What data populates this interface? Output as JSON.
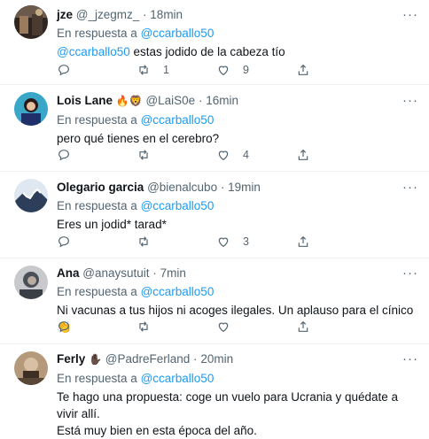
{
  "tweets": [
    {
      "name": "jze",
      "badges": "",
      "handle": "@_jzegmz_",
      "time": "18min",
      "reply_prefix": "En respuesta a",
      "reply_to": "@ccarballo50",
      "text_mention": "@ccarballo50",
      "text": " estas jodido de la cabeza tío",
      "retweets": "1",
      "likes": "9",
      "avatar_colors": [
        "#3b2a22",
        "#8a6a52"
      ]
    },
    {
      "name": "Lois Lane",
      "badges": "🔥🦁",
      "handle": "@LaiS0e",
      "time": "16min",
      "reply_prefix": "En respuesta a",
      "reply_to": "@ccarballo50",
      "text": "pero qué tienes en el cerebro?",
      "retweets": "",
      "likes": "4",
      "avatar_colors": [
        "#3aa6c8",
        "#1f2f6a"
      ]
    },
    {
      "name": "Olegario garcia",
      "badges": "",
      "handle": "@bienalcubo",
      "time": "19min",
      "reply_prefix": "En respuesta a",
      "reply_to": "@ccarballo50",
      "text": "Eres un jodid* tarad*",
      "retweets": "",
      "likes": "3",
      "avatar_colors": [
        "#dfe8f0",
        "#2c3e5a"
      ]
    },
    {
      "name": "Ana",
      "badges": "",
      "handle": "@anaysutuit",
      "time": "7min",
      "reply_prefix": "En respuesta a",
      "reply_to": "@ccarballo50",
      "text": "Ni vacunas a tus hijos ni acoges ilegales. Un aplauso para el cínico 👏",
      "retweets": "",
      "likes": "",
      "avatar_colors": [
        "#c7c9cc",
        "#4a4f57"
      ]
    },
    {
      "name": "Ferly",
      "badges": "✋🏿",
      "handle": "@PadreFerland",
      "time": "20min",
      "reply_prefix": "En respuesta a",
      "reply_to": "@ccarballo50",
      "text": "Te hago una propuesta: coge un vuelo para Ucrania y quédate a vivir allí.",
      "text2": "Está muy bien en esta época del año.",
      "retweets": "",
      "likes": "",
      "avatar_colors": [
        "#b49a7a",
        "#3d2d22"
      ]
    }
  ],
  "icons": {
    "reply": "reply-icon",
    "retweet": "retweet-icon",
    "like": "like-icon",
    "share": "share-icon",
    "more": "more-icon"
  },
  "colors": {
    "link": "#1d9bf0",
    "secondary": "#536471",
    "divider": "#eff3f4"
  }
}
